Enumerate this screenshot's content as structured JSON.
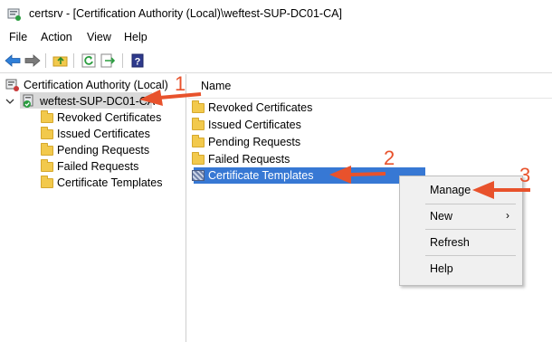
{
  "window": {
    "title": "certsrv - [Certification Authority (Local)\\weftest-SUP-DC01-CA]",
    "app_icon": "certsrv-icon"
  },
  "menubar": {
    "items": [
      {
        "label": "File"
      },
      {
        "label": "Action"
      },
      {
        "label": "View"
      },
      {
        "label": "Help"
      }
    ]
  },
  "toolbar": {
    "buttons": [
      "back-icon",
      "forward-icon",
      "up-folder-icon",
      "refresh-icon",
      "export-icon",
      "help-icon"
    ]
  },
  "tree": {
    "root": "Certification Authority (Local)",
    "ca": "weftest-SUP-DC01-CA",
    "children": [
      {
        "label": "Revoked Certificates"
      },
      {
        "label": "Issued Certificates"
      },
      {
        "label": "Pending Requests"
      },
      {
        "label": "Failed Requests"
      },
      {
        "label": "Certificate Templates"
      }
    ]
  },
  "list": {
    "column_name": "Name",
    "items": [
      {
        "label": "Revoked Certificates"
      },
      {
        "label": "Issued Certificates"
      },
      {
        "label": "Pending Requests"
      },
      {
        "label": "Failed Requests"
      },
      {
        "label": "Certificate Templates",
        "selected": true
      }
    ]
  },
  "context_menu": {
    "items": [
      {
        "label": "Manage"
      },
      {
        "label": "New",
        "submenu": true
      },
      {
        "label": "Refresh"
      },
      {
        "label": "Help"
      }
    ]
  },
  "annotations": {
    "step1": "1",
    "step2": "2",
    "step3": "3",
    "color": "#e8522c"
  },
  "colors": {
    "selection": "#3778d4",
    "folder": "#f2c94c"
  }
}
